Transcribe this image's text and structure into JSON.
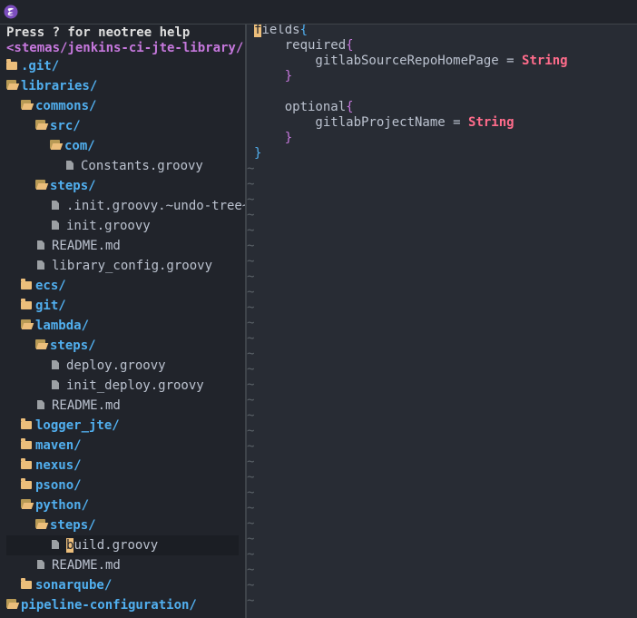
{
  "sidebar": {
    "help_text": "Press ? for neotree help",
    "root_path": "<stemas/jenkins-ci-jte-library/",
    "tree": [
      {
        "name": ".git/",
        "type": "dir",
        "open": false,
        "depth": 0
      },
      {
        "name": "libraries/",
        "type": "dir",
        "open": true,
        "depth": 0
      },
      {
        "name": "commons/",
        "type": "dir",
        "open": true,
        "depth": 1
      },
      {
        "name": "src/",
        "type": "dir",
        "open": true,
        "depth": 2
      },
      {
        "name": "com/",
        "type": "dir",
        "open": true,
        "depth": 3
      },
      {
        "name": "Constants.groovy",
        "type": "file",
        "depth": 4
      },
      {
        "name": "steps/",
        "type": "dir",
        "open": true,
        "depth": 2
      },
      {
        "name": ".init.groovy.~undo-tree~",
        "type": "file",
        "depth": 3
      },
      {
        "name": "init.groovy",
        "type": "file",
        "depth": 3
      },
      {
        "name": "README.md",
        "type": "file",
        "depth": 2
      },
      {
        "name": "library_config.groovy",
        "type": "file",
        "depth": 2
      },
      {
        "name": "ecs/",
        "type": "dir",
        "open": false,
        "depth": 1
      },
      {
        "name": "git/",
        "type": "dir",
        "open": false,
        "depth": 1
      },
      {
        "name": "lambda/",
        "type": "dir",
        "open": true,
        "depth": 1
      },
      {
        "name": "steps/",
        "type": "dir",
        "open": true,
        "depth": 2
      },
      {
        "name": "deploy.groovy",
        "type": "file",
        "depth": 3
      },
      {
        "name": "init_deploy.groovy",
        "type": "file",
        "depth": 3
      },
      {
        "name": "README.md",
        "type": "file",
        "depth": 2
      },
      {
        "name": "logger_jte/",
        "type": "dir",
        "open": false,
        "depth": 1
      },
      {
        "name": "maven/",
        "type": "dir",
        "open": false,
        "depth": 1
      },
      {
        "name": "nexus/",
        "type": "dir",
        "open": false,
        "depth": 1
      },
      {
        "name": "psono/",
        "type": "dir",
        "open": false,
        "depth": 1
      },
      {
        "name": "python/",
        "type": "dir",
        "open": true,
        "depth": 1
      },
      {
        "name": "steps/",
        "type": "dir",
        "open": true,
        "depth": 2
      },
      {
        "name": "build.groovy",
        "type": "file",
        "depth": 3,
        "selected": true
      },
      {
        "name": "README.md",
        "type": "file",
        "depth": 2
      },
      {
        "name": "sonarqube/",
        "type": "dir",
        "open": false,
        "depth": 1
      },
      {
        "name": "pipeline-configuration/",
        "type": "dir",
        "open": true,
        "depth": 0
      }
    ]
  },
  "editor": {
    "lines": [
      [
        {
          "t": "fields",
          "c": "tok-key",
          "cursor": true
        },
        {
          "t": "{",
          "c": "tok-brace"
        }
      ],
      [
        {
          "t": "    required",
          "c": "tok-key"
        },
        {
          "t": "{",
          "c": "tok-brace2"
        }
      ],
      [
        {
          "t": "        gitlabSourceRepoHomePage ",
          "c": "tok-key"
        },
        {
          "t": "= ",
          "c": "tok-op"
        },
        {
          "t": "String",
          "c": "tok-type"
        }
      ],
      [
        {
          "t": "    ",
          "c": "tok-key"
        },
        {
          "t": "}",
          "c": "tok-brace2"
        }
      ],
      [
        {
          "t": "",
          "c": "tok-key"
        }
      ],
      [
        {
          "t": "    optional",
          "c": "tok-key"
        },
        {
          "t": "{",
          "c": "tok-brace2"
        }
      ],
      [
        {
          "t": "        gitlabProjectName ",
          "c": "tok-key"
        },
        {
          "t": "= ",
          "c": "tok-op"
        },
        {
          "t": "String",
          "c": "tok-type"
        }
      ],
      [
        {
          "t": "    ",
          "c": "tok-key"
        },
        {
          "t": "}",
          "c": "tok-brace2"
        }
      ],
      [
        {
          "t": "}",
          "c": "tok-brace"
        }
      ]
    ],
    "empty_marker": "~",
    "empty_line_count": 29
  },
  "colors": {
    "background": "#282c34",
    "sidebar_background": "#21242b",
    "directory": "#51afef",
    "folder_icon": "#ecbe7b",
    "root_path": "#c678dd",
    "type_keyword": "#ff6c8b"
  }
}
